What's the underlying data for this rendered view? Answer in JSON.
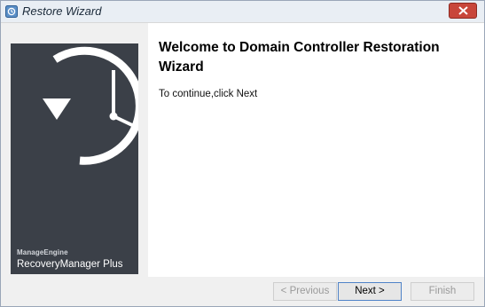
{
  "window": {
    "title": "Restore Wizard",
    "icon": "recovery-manager-app-icon"
  },
  "banner": {
    "brand_small": "ManageEngine",
    "brand_big": "RecoveryManager Plus",
    "art_icon": "clock-restore-icon"
  },
  "main": {
    "heading": "Welcome to Domain Controller Restoration Wizard",
    "instruction": "To continue,click Next"
  },
  "footer": {
    "previous_label": "< Previous",
    "next_label": "Next >",
    "finish_label": "Finish"
  },
  "colors": {
    "banner_bg": "#3b4048",
    "close_button": "#c8463a",
    "default_button_border": "#4f83c8"
  }
}
